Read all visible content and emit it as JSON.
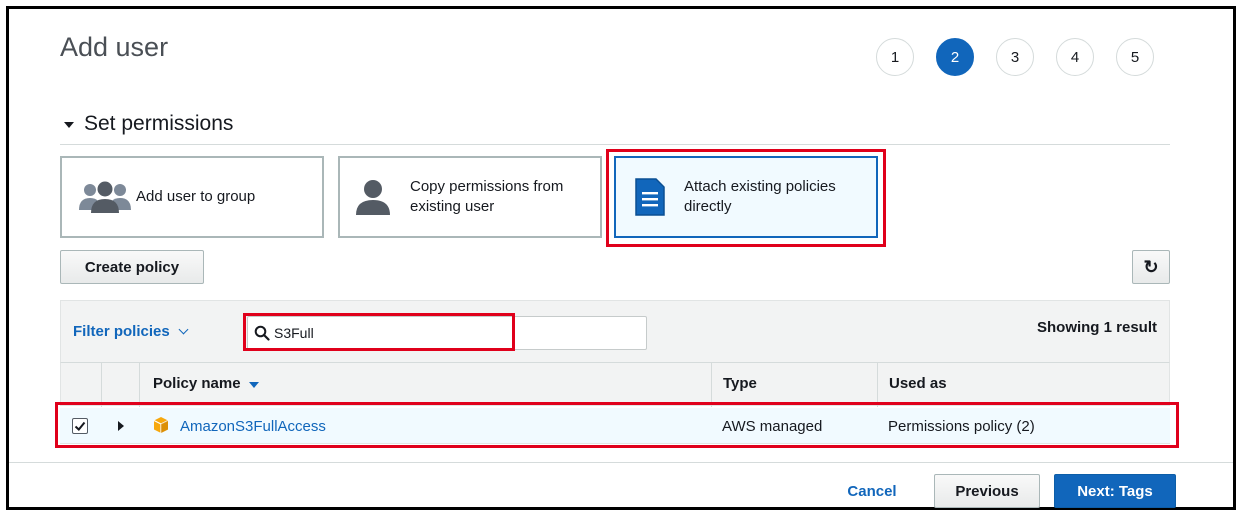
{
  "page": {
    "title": "Add user"
  },
  "steps": [
    {
      "label": "1",
      "active": false
    },
    {
      "label": "2",
      "active": true
    },
    {
      "label": "3",
      "active": false
    },
    {
      "label": "4",
      "active": false
    },
    {
      "label": "5",
      "active": false
    }
  ],
  "section": {
    "title": "Set permissions"
  },
  "options": [
    {
      "label": "Add user to group",
      "icon": "user-group-icon",
      "selected": false
    },
    {
      "label": "Copy permissions from existing user",
      "icon": "user-icon",
      "selected": false
    },
    {
      "label": "Attach existing policies directly",
      "icon": "document-icon",
      "selected": true
    }
  ],
  "toolbar": {
    "create_policy_label": "Create policy",
    "refresh_icon": "refresh-icon"
  },
  "filter": {
    "label": "Filter policies",
    "search_value": "S3Full",
    "result_text": "Showing 1 result"
  },
  "table": {
    "columns": [
      "Policy name",
      "Type",
      "Used as"
    ],
    "rows": [
      {
        "selected": true,
        "name": "AmazonS3FullAccess",
        "type": "AWS managed",
        "used_as": "Permissions policy (2)"
      }
    ]
  },
  "footer": {
    "cancel_label": "Cancel",
    "previous_label": "Previous",
    "next_label": "Next: Tags"
  },
  "colors": {
    "accent": "#1166bb",
    "highlight": "#e0001b",
    "selected_bg": "#f1faff",
    "policy_icon": "#f7a80d"
  }
}
